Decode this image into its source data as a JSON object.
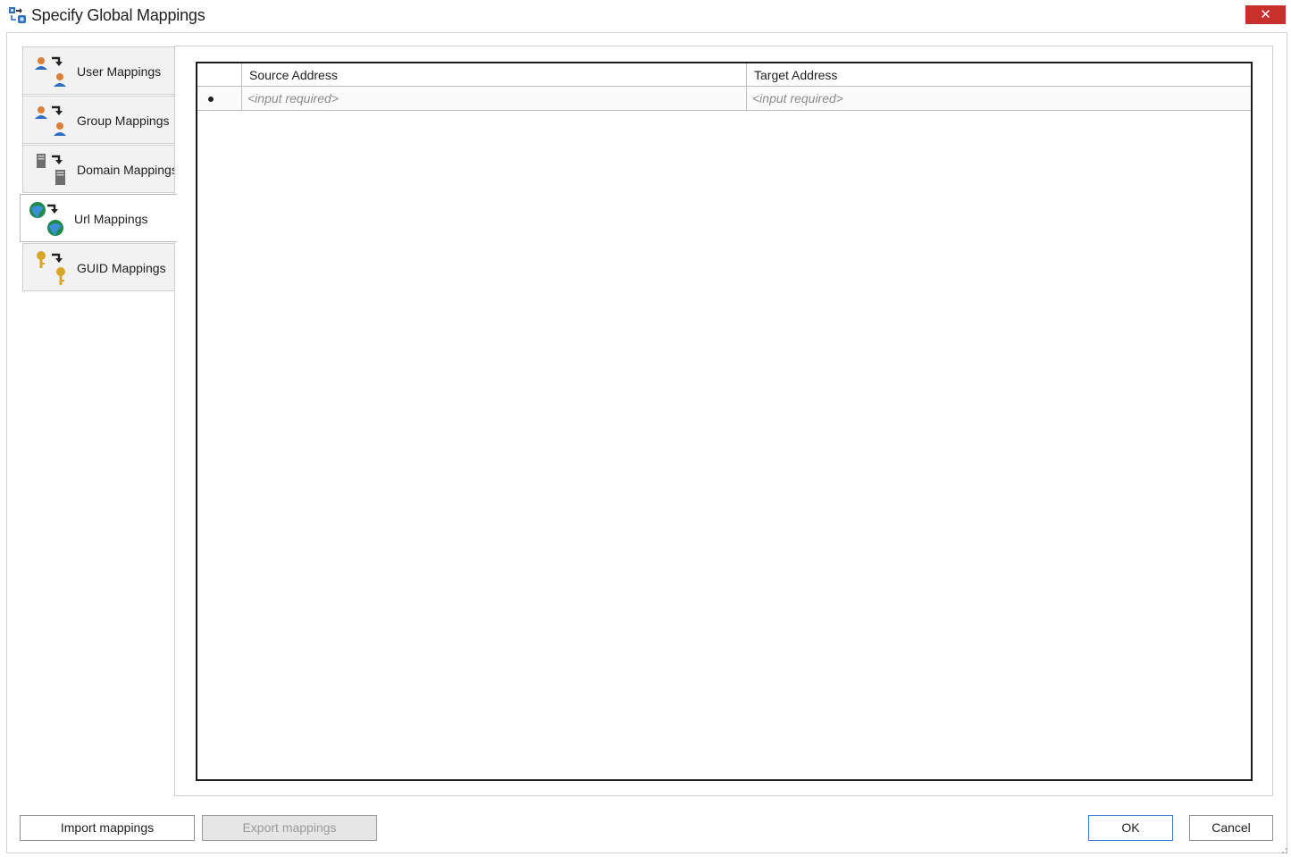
{
  "window": {
    "title": "Specify Global Mappings",
    "close_label": "✕"
  },
  "tabs": [
    {
      "label": "User Mappings",
      "icon": "user-mapping-icon",
      "active": false
    },
    {
      "label": "Group Mappings",
      "icon": "group-mapping-icon",
      "active": false
    },
    {
      "label": "Domain Mappings",
      "icon": "domain-mapping-icon",
      "active": false
    },
    {
      "label": "Url Mappings",
      "icon": "url-mapping-icon",
      "active": true
    },
    {
      "label": "GUID Mappings",
      "icon": "guid-mapping-icon",
      "active": false
    }
  ],
  "grid": {
    "columns": [
      "Source Address",
      "Target Address"
    ],
    "new_row": {
      "source_placeholder": "<input required>",
      "target_placeholder": "<input required>"
    }
  },
  "footer": {
    "import_label": "Import mappings",
    "export_label": "Export mappings",
    "export_enabled": false,
    "ok_label": "OK",
    "cancel_label": "Cancel"
  },
  "colors": {
    "close_button": "#c7302b",
    "default_button_border": "#3b7bd4",
    "placeholder_text": "#8a8a8a"
  }
}
